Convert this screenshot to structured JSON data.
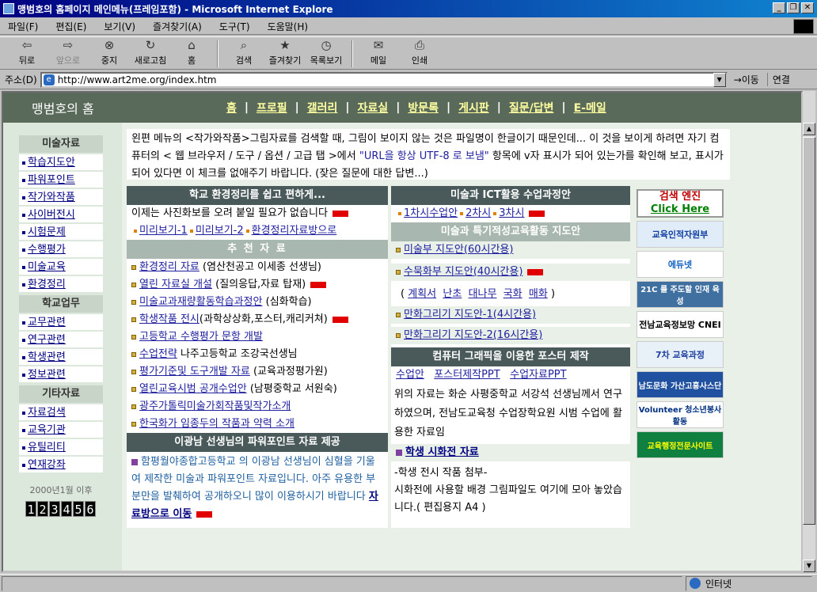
{
  "window": {
    "title": "맹범호의 홈페이지 메인메뉴(프레임포함) - Microsoft Internet Explore"
  },
  "menu": [
    "파일(F)",
    "편집(E)",
    "보기(V)",
    "즐겨찾기(A)",
    "도구(T)",
    "도움말(H)"
  ],
  "toolbar": [
    {
      "label": "뒤로",
      "icon": "back-arrow-icon",
      "glyph": "⇦",
      "disabled": false
    },
    {
      "label": "앞으로",
      "icon": "forward-arrow-icon",
      "glyph": "⇨",
      "disabled": true
    },
    {
      "label": "중지",
      "icon": "stop-icon",
      "glyph": "⊗",
      "disabled": false
    },
    {
      "label": "새로고침",
      "icon": "refresh-icon",
      "glyph": "↻",
      "disabled": false
    },
    {
      "label": "홈",
      "icon": "home-icon",
      "glyph": "⌂",
      "disabled": false
    },
    {
      "label": "검색",
      "icon": "search-icon",
      "glyph": "⌕",
      "disabled": false
    },
    {
      "label": "즐겨찾기",
      "icon": "favorites-icon",
      "glyph": "★",
      "disabled": false
    },
    {
      "label": "목록보기",
      "icon": "history-icon",
      "glyph": "◷",
      "disabled": false
    },
    {
      "label": "메일",
      "icon": "mail-icon",
      "glyph": "✉",
      "disabled": false
    },
    {
      "label": "인쇄",
      "icon": "print-icon",
      "glyph": "⎙",
      "disabled": false
    }
  ],
  "address": {
    "label": "주소(D)",
    "url": "http://www.art2me.org/index.htm",
    "go": "이동",
    "links": "연결"
  },
  "page": {
    "home_title": "맹범호의 홈",
    "nav": [
      "홈",
      "프로필",
      "갤러리",
      "자료실",
      "방문록",
      "게시판",
      "질문/답변",
      "E-메일"
    ],
    "sidebar": {
      "sections": [
        {
          "title": "미술자료",
          "items": [
            "학습지도안",
            "파워포인트",
            "작가와작품",
            "사이버전시",
            "시험문제",
            "수행평가",
            "미술교육",
            "환경정리"
          ]
        },
        {
          "title": "학교업무",
          "items": [
            "교무관련",
            "연구관련",
            "학생관련",
            "정보관련"
          ]
        },
        {
          "title": "기타자료",
          "items": [
            "자료검색",
            "교육기관",
            "유틸리티",
            "연재강좌"
          ]
        }
      ],
      "counter_label": "2000년1월 이후",
      "counter_digits": [
        "1",
        "2",
        "3",
        "4",
        "5",
        "6"
      ]
    },
    "notice": {
      "part1": "왼편 메뉴의 <작가와작품>그림자료를 검색할 때, 그림이  보이지 않는 것은 파일명이 한글이기 때문인데... 이 것을 보이게 하려면 자기 컴퓨터의 < 웹 브라우저 / 도구 / 옵션 / 고급 탭 >에서 ",
      "highlight": "\"URL을 항상 UTF-8 로 보냄\"",
      "part2": " 항목에 v자 표시가 되어 있는가를 확인해 보고, 표시가 되어 있다면 이 체크를  없애주기 바랍니다.  (잦은 질문에 대한 답변...)"
    },
    "col1": {
      "head": "학교 환경정리를 쉽고 편하게...",
      "intro": "이제는 사진화보를 오려 붙일 필요가 없습니다",
      "links": [
        "미리보기-1",
        "미리보기-2",
        "환경정리자료방으로"
      ],
      "rec_head": "추 천 자 료",
      "rec": [
        {
          "link": "환경정리 자료",
          "rest": " (염산천공고 이세종 선생님)",
          "new": false
        },
        {
          "link": "열린 자료실 개설",
          "rest": " (질의응답,자료 탑재)",
          "new": true
        },
        {
          "link": "미술교과재량활동학습과정안",
          "rest": " (심화학습)",
          "new": false
        },
        {
          "link": "학생작품 전시",
          "rest": "(과학상상화,포스터,캐리커쳐)",
          "new": true
        },
        {
          "link": "고등학교 수행평가 문항 개발",
          "rest": "",
          "new": false
        },
        {
          "link": "수업전략",
          "rest": " 나주고등학교 조강국선생님",
          "new": false
        },
        {
          "link": "평가기준및 도구개발 자료",
          "rest": " (교육과정평가원)",
          "new": false
        },
        {
          "link": "열린교육시범 공개수업안",
          "rest": " (남평중학교 서원숙)",
          "new": false
        },
        {
          "link": "광주가톨릭미술가회작품및작가소개",
          "rest": "",
          "new": false
        },
        {
          "link": "한국화가 임종두의 작품과 약력 소개",
          "rest": "",
          "new": false
        }
      ],
      "ppt_head": "이광남 선생님의 파워포인트 자료 제공",
      "ppt_text": "함평월야종합고등학교 의 이광남 선생님이 심혈을 기울여 제작한 미술과 파워포인트 자료입니다. 아주 유용한  부분만을 발췌하여 공개하오니  많이 이용하시기 바랍니다",
      "ppt_link": "자료방으로 이동"
    },
    "col2": {
      "ict_head": "미술과 ICT활용 수업과정안",
      "ict_links": [
        "1차시수업안",
        "2차시",
        "3차시"
      ],
      "spec_head": "미술과 특기적성교육활동 지도안",
      "spec": [
        "미술부 지도안(60시간용)",
        "수묵화부 지도안(40시간용)"
      ],
      "sub": [
        "계획서",
        "난초",
        "대나무",
        "국화",
        "매화"
      ],
      "spec2": [
        "만화그리기 지도안-1(4시간용)",
        "만화그리기 지도안-2(16시간용)"
      ],
      "cg_head": "컴퓨터 그래픽을 이용한 포스터 제작",
      "cg_links": [
        "수업안",
        "포스터제작PPT",
        "수업자료PPT"
      ],
      "cg_text": "위의 자료는 화순 사평중학교 서강석 선생님께서 연구하였으며,  전남도교육청 수업장학요원 시범 수업에 활용한 자료임",
      "exh_link": "학생 시화전 자료",
      "exh_text": "-학생 전시 작품 첨부-\n시화전에 사용할  배경 그림파일도 여기에 모아 놓았습니다.( 편집용지 A4 )"
    },
    "col3": {
      "search_title": "검색 엔진",
      "search_click": "Click Here",
      "banners": [
        "교육인적자원부",
        "에듀넷",
        "21C 를 주도할 인재 육성",
        "전남교육정보망 CNEI",
        "7차 교육과정",
        "남도문화 가산고흥사스단",
        "Volunteer 청소년봉사활동",
        "교육행정전문사이트"
      ]
    },
    "status": {
      "zone": "인터넷"
    }
  },
  "colors": {
    "nav_bg": "#5a6a5a",
    "nav_link": "#ffffa0",
    "head_dark": "#4a5a5a",
    "link": "#2020a0"
  }
}
